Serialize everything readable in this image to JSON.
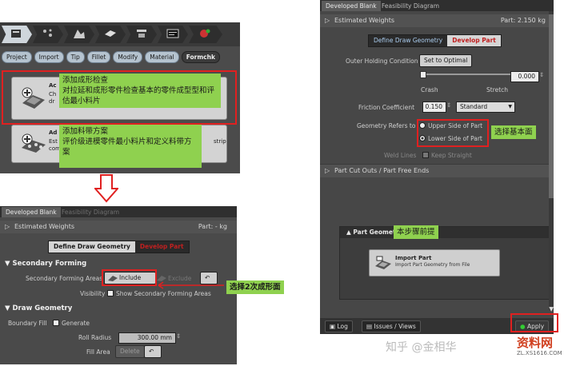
{
  "toolbar": {
    "tabs": [
      "Project",
      "Import",
      "Tip",
      "Fillet",
      "Modify",
      "Material",
      "Formchk"
    ],
    "icons": [
      "blank-icon",
      "mesh-icon",
      "form-icon",
      "sheet-icon",
      "press-icon",
      "report-icon",
      "tool-icon"
    ]
  },
  "left_top": {
    "btn1_title_prefix": "Ac",
    "btn1_sub1": "Ch",
    "btn1_sub2": "dr",
    "btn2_title_prefix": "Ad",
    "btn2_sub1": "Est",
    "btn2_sub2": "com",
    "btn2_sub_right": "strip",
    "note1": "添加成形检查\n对拉延和成形零件检查基本的零件成型型和评估最小料片",
    "note2": "添加料带方案\n评价级进模零件最小料片和定义料带方案"
  },
  "left_bottom": {
    "tabs": [
      "Developed Blank",
      "Feasibility Diagram"
    ],
    "estimated_weights": "Estimated Weights",
    "part_weight": "Part: - kg",
    "seg_on": "Define Draw Geometry",
    "seg_off": "Develop Part",
    "secondary_forming": "Secondary Forming",
    "secondary_forming_areas": "Secondary Forming Areas",
    "include": "Include",
    "exclude": "Exclude",
    "visibility": "Visibility",
    "show_secondary": "Show Secondary Forming Areas",
    "draw_geometry": "Draw Geometry",
    "boundary_fill": "Boundary Fill",
    "generate": "Generate",
    "roll_radius": "Roll Radius",
    "roll_radius_value": "300.00 mm",
    "fill_area": "Fill Area",
    "delete": "Delete",
    "note": "选择2次成形面"
  },
  "right": {
    "tabs": [
      "Developed Blank",
      "Feasibility Diagram"
    ],
    "estimated_weights": "Estimated Weights",
    "part_weight": "Part: 2.150 kg",
    "seg_off": "Define Draw Geometry",
    "seg_on": "Develop Part",
    "outer_holding": "Outer Holding Condition",
    "set_optimal": "Set to Optimal",
    "slider_value": "0.000",
    "crash": "Crash",
    "stretch": "Stretch",
    "friction": "Friction Coefficient",
    "friction_value": "0.150",
    "friction_mode": "Standard",
    "geometry_refers": "Geometry Refers to",
    "upper_side": "Upper Side of Part",
    "lower_side": "Lower Side of Part",
    "weld_lines": "Weld Lines",
    "keep_straight": "Keep Straight",
    "part_cutouts": "Part Cut Outs / Part Free Ends",
    "part_geometry": "Part Geometry",
    "import_part": "Import Part",
    "import_part_sub": "Import Part Geometry from File",
    "note_base": "选择基本面",
    "note_step": "本步骤前提",
    "log": "Log",
    "issues": "Issues / Views",
    "apply": "Apply"
  },
  "watermark": {
    "zhihu": "知乎 @金相华",
    "site": "资料网",
    "site_url": "ZL.XS1616.COM"
  },
  "colors": {
    "note_green": "#8fd14f",
    "highlight_red": "#e02020",
    "panel": "#4a4a4a"
  }
}
